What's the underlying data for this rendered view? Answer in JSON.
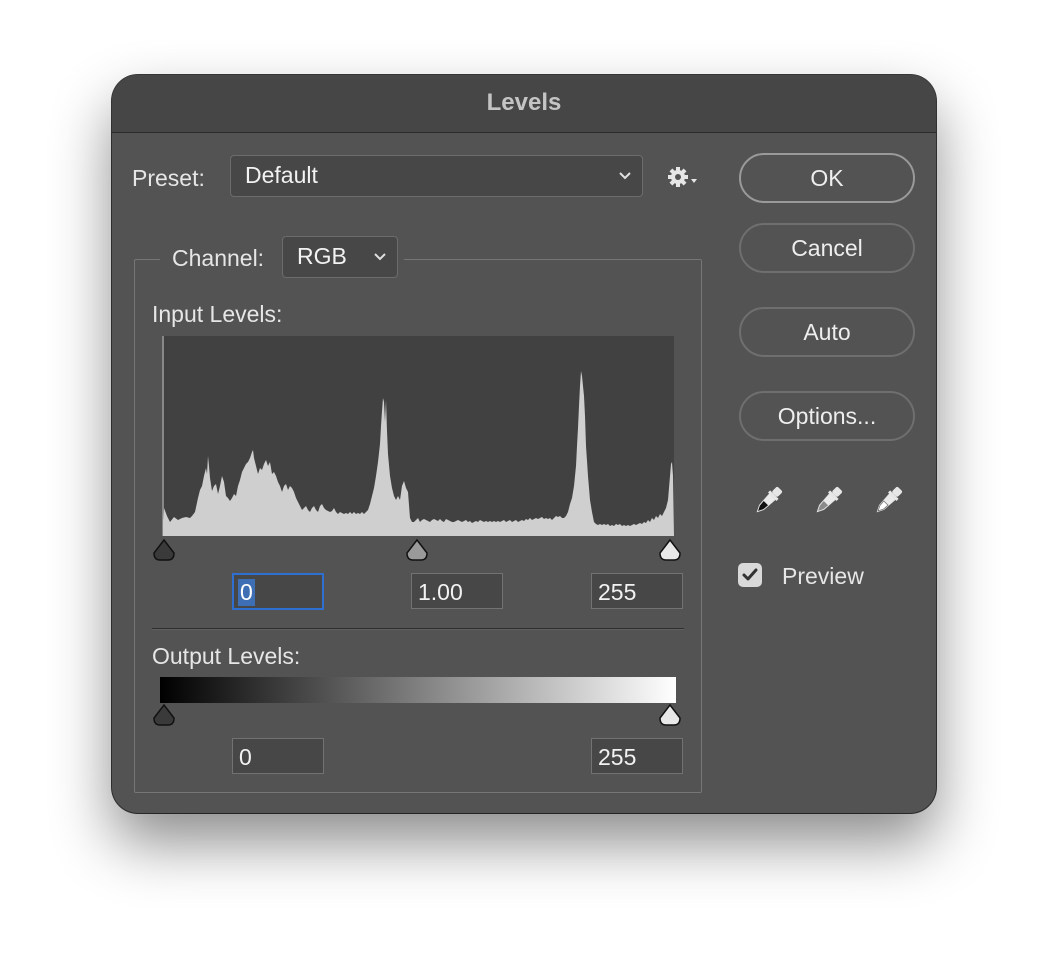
{
  "window": {
    "title": "Levels"
  },
  "preset": {
    "label": "Preset:",
    "value": "Default",
    "menu_icon": "gear-icon"
  },
  "channel": {
    "label": "Channel:",
    "value": "RGB"
  },
  "input_levels": {
    "label": "Input Levels:",
    "black": "0",
    "gamma": "1.00",
    "white": "255"
  },
  "output_levels": {
    "label": "Output Levels:",
    "black": "0",
    "white": "255"
  },
  "buttons": {
    "ok": "OK",
    "cancel": "Cancel",
    "auto": "Auto",
    "options": "Options..."
  },
  "eyedroppers": [
    "black-point-eyedropper-icon",
    "gray-point-eyedropper-icon",
    "white-point-eyedropper-icon"
  ],
  "preview": {
    "label": "Preview",
    "checked": true
  },
  "colors": {
    "dialog_bg": "#535353",
    "focus": "#2f6fd0",
    "histogram": "#cfcfcf"
  }
}
